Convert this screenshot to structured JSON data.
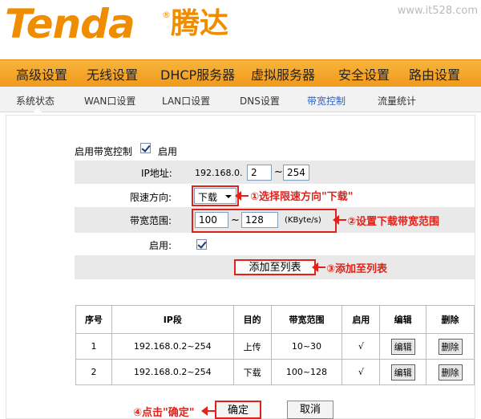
{
  "header": {
    "logo_text": "Tenda",
    "logo_reg": "®",
    "logo_cn": "腾达",
    "watermark": "www.it528.com"
  },
  "main_nav": [
    "高级设置",
    "无线设置",
    "DHCP服务器",
    "虚拟服务器",
    "安全设置",
    "路由设置"
  ],
  "sub_nav": {
    "items": [
      "系统状态",
      "WAN口设置",
      "LAN口设置",
      "DNS设置",
      "带宽控制",
      "流量统计"
    ],
    "active_index": 4
  },
  "form": {
    "enable_bw_label": "启用带宽控制",
    "enable_bw_checked": true,
    "enable_bw_text": "启用",
    "ip_label": "IP地址:",
    "ip_prefix": "192.168.0.",
    "ip_start": "2",
    "ip_tilde": "~",
    "ip_end": "254",
    "direction_label": "限速方向:",
    "direction_value": "下载",
    "range_label": "带宽范围:",
    "range_min": "100",
    "range_tilde": "~",
    "range_max": "128",
    "range_unit": "(KByte/s)",
    "enable_label": "启用:",
    "enable_checked": true,
    "add_button": "添加至列表"
  },
  "annotations": {
    "a1": "①选择限速方向\"下载\"",
    "a2": "②设置下载带宽范围",
    "a3": "③添加至列表",
    "a4": "④点击\"确定\""
  },
  "table": {
    "headers": [
      "序号",
      "IP段",
      "目的",
      "带宽范围",
      "启用",
      "编辑",
      "删除"
    ],
    "rows": [
      {
        "idx": "1",
        "ip": "192.168.0.2~254",
        "dir": "上传",
        "range": "10~30",
        "enabled": "√",
        "edit": "编辑",
        "del": "删除"
      },
      {
        "idx": "2",
        "ip": "192.168.0.2~254",
        "dir": "下载",
        "range": "100~128",
        "enabled": "√",
        "edit": "编辑",
        "del": "删除"
      }
    ]
  },
  "footer": {
    "ok_button": "确定",
    "cancel_button": "取消"
  },
  "colors": {
    "accent_orange": "#f08c00",
    "annotation_red": "#e0231a",
    "active_tab_blue": "#2a62c9"
  }
}
